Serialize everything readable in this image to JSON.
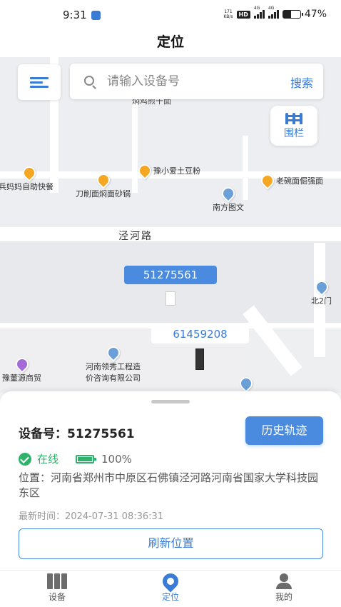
{
  "status_bar": {
    "time": "9:31",
    "net_speed_top": "171",
    "net_speed_bottom": "KB/s",
    "hd": "HD",
    "signal_1": "4G",
    "signal_2": "4G",
    "battery": "47%",
    "battery_level": 0.47
  },
  "header": {
    "title": "定位"
  },
  "map": {
    "search": {
      "placeholder": "请输入设备号",
      "button": "搜索"
    },
    "fence_button": "围栏",
    "road_label": "泾河路",
    "poi_top_cut": "焖鸡煎干面",
    "pois": {
      "p1": "豫小爱土豆粉",
      "p2": "兵妈妈自助快餐",
      "p3": "刀削面焖面砂锅",
      "p4": "南方图文",
      "p5": "老碗面倔强面",
      "p6": "北2门",
      "p7": "豫董源商贸",
      "p8_line1": "河南领秀工程造",
      "p8_line2": "价咨询有限公司"
    },
    "devices": [
      {
        "id": "51275561",
        "active": true
      },
      {
        "id": "61459208",
        "active": false
      }
    ]
  },
  "sheet": {
    "device_label": "设备号：",
    "device_number": "51275561",
    "history_button": "历史轨迹",
    "online_status": "在线",
    "battery_text": "100%",
    "address": "位置：河南省郑州市中原区石佛镇泾河路河南省国家大学科技园东区",
    "update_time": "最新时间：2024-07-31 08:36:31",
    "refresh_button": "刷新位置"
  },
  "tabs": [
    {
      "label": "设备",
      "active": false
    },
    {
      "label": "定位",
      "active": true
    },
    {
      "label": "我的",
      "active": false
    }
  ],
  "colors": {
    "accent": "#3a7bd5",
    "online": "#2fb36c"
  }
}
